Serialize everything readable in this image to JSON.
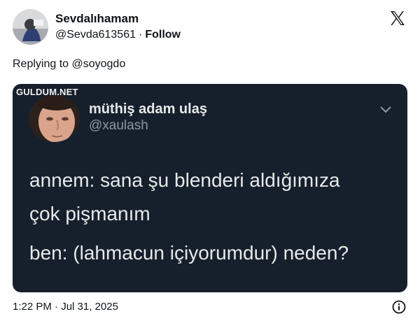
{
  "author": {
    "display_name": "Sevdalıhamam",
    "handle": "@Sevda613561",
    "separator": "·",
    "follow_label": "Follow",
    "avatar_icon": "user-avatar"
  },
  "brand_icon": "x-logo-icon",
  "reply": {
    "text": "Replying to @soyogdo"
  },
  "embedded_tweet": {
    "watermark": "GULDUM.NET",
    "author_name": "müthiş adam ulaş",
    "author_handle": "@xaulash",
    "menu_icon": "chevron-down-icon",
    "lines": [
      "annem: sana şu blenderi aldığımıza",
      "çok pişmanım",
      "ben: (lahmacun içiyorumdur) neden?"
    ]
  },
  "footer": {
    "timestamp": "1:22 PM · Jul 31, 2025",
    "info_icon": "info-icon"
  },
  "colors": {
    "card_bg": "#16202c",
    "text_primary": "#0f1419",
    "inner_text": "#e7e9ea",
    "inner_muted": "#8b98a5"
  }
}
